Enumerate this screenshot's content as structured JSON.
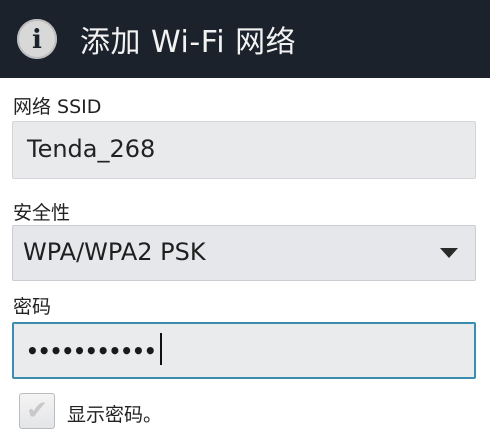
{
  "dialog": {
    "title": "添加 Wi-Fi 网络",
    "title_icon": "info-icon",
    "title_icon_glyph": "i",
    "title_bar_color": "#1b222c"
  },
  "ssid": {
    "label": "网络 SSID",
    "value": "Tenda_268"
  },
  "security": {
    "label": "安全性",
    "selected": "WPA/WPA2 PSK",
    "dropdown_icon": "triangle-down-icon"
  },
  "password": {
    "label": "密码",
    "value": "•••••••••••",
    "focus_color": "#3b8db0"
  },
  "show_password": {
    "label": "显示密码。",
    "checked": false,
    "check_icon": "checkmark-icon",
    "check_glyph": "✔"
  }
}
